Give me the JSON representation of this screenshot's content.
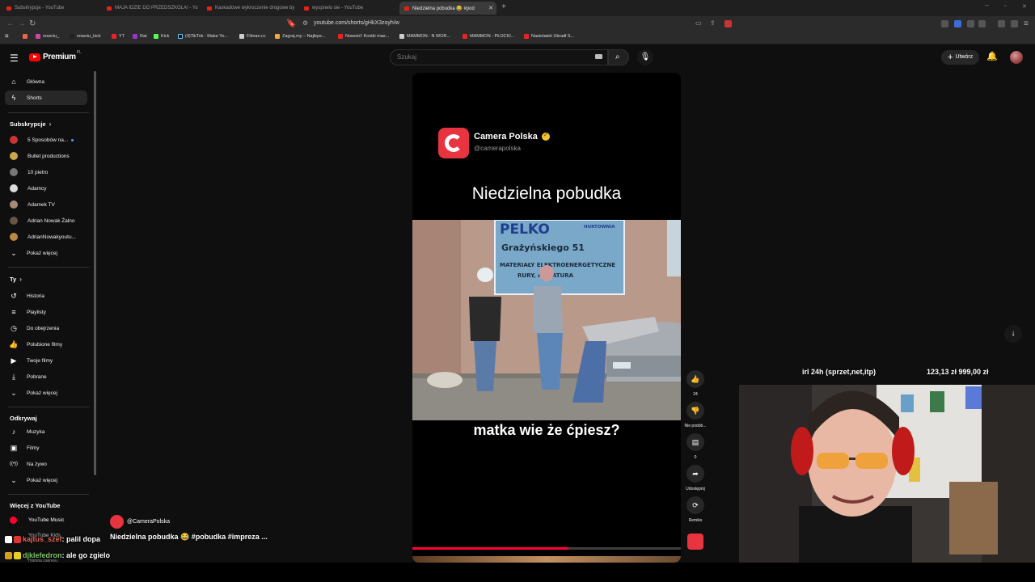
{
  "browser": {
    "tabs": [
      {
        "label": "Subskrypcje - YouTube"
      },
      {
        "label": "MAJA IDZIE DO PRZEDSZKOLA! - Yo"
      },
      {
        "label": "Kaskadowe wykroczenie drogowe by"
      },
      {
        "label": "wyspnelo sie - YouTube"
      },
      {
        "label": "Niedzielna pobudka 😂 #pod"
      }
    ],
    "new_tab": "+",
    "url": "youtube.com/shorts/gHkX3zoyh/w",
    "bookmarks": [
      "nowciu_",
      "nowciu_kick",
      "YT",
      "Rat",
      "Kick",
      "(4)TikTok - Make Yo...",
      "Filman.cc",
      "Zagraj.my – Najleps...",
      "Nowość! Kostki mas...",
      "MAMMON - N WOR...",
      "MAMMON - PŁOCKI...",
      "Nastolatek Ukradł S..."
    ],
    "colors": {
      "tab_bg": "#1f1f1f",
      "active_tab": "#3a3a3a",
      "bar": "#2b2b2b"
    }
  },
  "header": {
    "logo_text": "Premium",
    "logo_region": "PL",
    "search_placeholder": "Szukaj",
    "create_label": "Utwórz",
    "icons": [
      "menu-icon",
      "search-icon",
      "mic-icon",
      "bell-icon",
      "keyboard-icon",
      "plus-icon"
    ]
  },
  "sidebar": {
    "main": [
      {
        "label": "Główna",
        "icon": "⌂"
      },
      {
        "label": "Shorts",
        "icon": "ϟ"
      }
    ],
    "subs_title": "Subskrypcje",
    "subs": [
      {
        "label": "5 Sposobów na...",
        "color": "#c33",
        "new": true
      },
      {
        "label": "Bullet productions",
        "color": "#c9a648"
      },
      {
        "label": "10 pietro",
        "color": "#777"
      },
      {
        "label": "Adamcy",
        "color": "#ddd"
      },
      {
        "label": "Adamek TV",
        "color": "#a87"
      },
      {
        "label": "Adrian Nowak Żalno",
        "color": "#654"
      },
      {
        "label": "AdrianNowakyoutu...",
        "color": "#b84"
      }
    ],
    "subs_more": "Pokaż więcej",
    "you_title": "Ty",
    "you": [
      {
        "label": "Historia",
        "icon": "↺"
      },
      {
        "label": "Playlisty",
        "icon": "≡"
      },
      {
        "label": "Do obejrzenia",
        "icon": "◷"
      },
      {
        "label": "Polubione filmy",
        "icon": "👍"
      },
      {
        "label": "Twoje filmy",
        "icon": "▶"
      },
      {
        "label": "Pobrane",
        "icon": "⤓"
      }
    ],
    "you_more": "Pokaż więcej",
    "explore_title": "Odkrywaj",
    "explore": [
      {
        "label": "Muzyka",
        "icon": "♪"
      },
      {
        "label": "Filmy",
        "icon": "▣"
      },
      {
        "label": "Na żywo",
        "icon": "((•))"
      }
    ],
    "explore_more": "Pokaż więcej",
    "more_title": "Więcej z YouTube",
    "more": [
      {
        "label": "YouTube Music"
      },
      {
        "label": "YouTube Kids"
      },
      {
        "label": "Historia zakresu"
      }
    ]
  },
  "short": {
    "channel_name": "Camera Polska",
    "channel_handle": "@camerapolska",
    "title": "Niedzielna pobudka",
    "caption": "matka wie że ćpiesz?",
    "sign_line1": "PELKO",
    "sign_line1b": "HURTOWNIA",
    "sign_line2": "Grażyńskiego 51",
    "sign_line3": "MATERIAŁY ELEKTROENERGETYCZNE",
    "sign_line4": "RURY, ARMATURA",
    "progress": 0.58,
    "bottom_channel": "@CameraPolska",
    "description": "Niedzielna pobudka 😂 #pobudka #impreza ..."
  },
  "actions": [
    {
      "name": "like",
      "icon": "👍",
      "label": "24"
    },
    {
      "name": "dislike",
      "icon": "👎",
      "label": "Nie podob..."
    },
    {
      "name": "comments",
      "icon": "▤",
      "label": "0"
    },
    {
      "name": "share",
      "icon": "➦",
      "label": "Udostępnij"
    },
    {
      "name": "remix",
      "icon": "⟳",
      "label": "Remiks"
    }
  ],
  "stream": {
    "goal_title": "irl 24h (sprzet,net,itp)",
    "goal_amount": "123,13 zł     999,00 zł",
    "chat": [
      {
        "user": "kajtus_szef",
        "message": " : palil dopa",
        "user_class": "user1"
      },
      {
        "user": "djklefedron",
        "message": " : ale go zgielo",
        "user_class": "user2"
      }
    ]
  }
}
